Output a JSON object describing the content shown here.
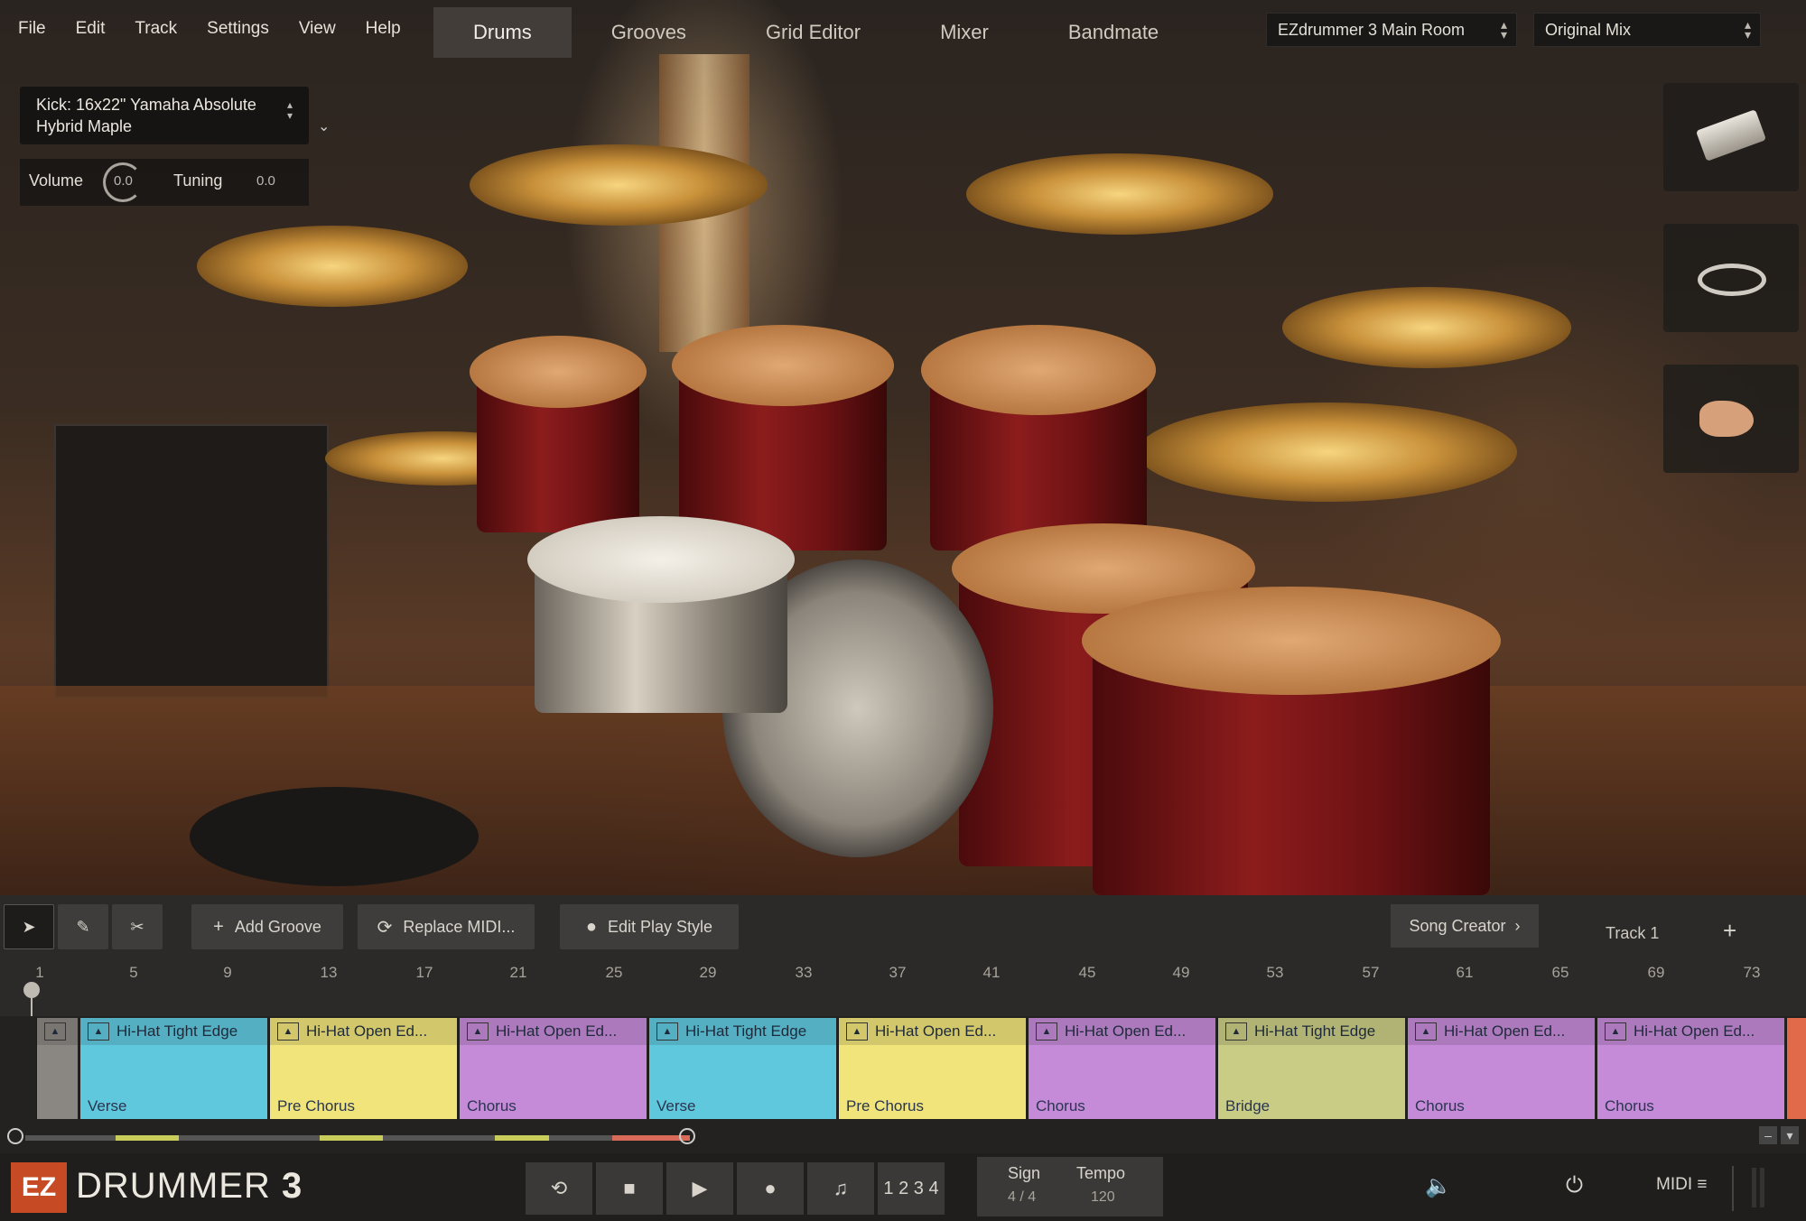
{
  "menu": [
    "File",
    "Edit",
    "Track",
    "Settings",
    "View",
    "Help"
  ],
  "tabs": [
    {
      "label": "Drums",
      "active": true
    },
    {
      "label": "Grooves",
      "active": false
    },
    {
      "label": "Grid Editor",
      "active": false
    },
    {
      "label": "Mixer",
      "active": false
    },
    {
      "label": "Bandmate",
      "active": false
    }
  ],
  "room_preset": "EZdrummer 3 Main Room",
  "mix_preset": "Original Mix",
  "instrument": {
    "name": "Kick: 16x22\" Yamaha Absolute Hybrid Maple",
    "volume_label": "Volume",
    "volume_value": "0.0",
    "tuning_label": "Tuning",
    "tuning_value": "0.0"
  },
  "toolbar": {
    "add_groove": "Add Groove",
    "replace_midi": "Replace MIDI...",
    "edit_play_style": "Edit Play Style",
    "song_creator": "Song Creator",
    "track_name": "Track 1"
  },
  "ruler": [
    "1",
    "5",
    "9",
    "13",
    "17",
    "21",
    "25",
    "29",
    "33",
    "37",
    "41",
    "45",
    "49",
    "53",
    "57",
    "61",
    "65",
    "69",
    "73"
  ],
  "clips": [
    {
      "title": "Hi-Hat Tight Edge",
      "part": "Verse",
      "color": "#5fc8dc"
    },
    {
      "title": "Hi-Hat Open Ed...",
      "part": "Pre Chorus",
      "color": "#f0e47a"
    },
    {
      "title": "Hi-Hat Open Ed...",
      "part": "Chorus",
      "color": "#c58ad8"
    },
    {
      "title": "Hi-Hat Tight Edge",
      "part": "Verse",
      "color": "#5fc8dc"
    },
    {
      "title": "Hi-Hat Open Ed...",
      "part": "Pre Chorus",
      "color": "#f0e47a"
    },
    {
      "title": "Hi-Hat Open Ed...",
      "part": "Chorus",
      "color": "#c58ad8"
    },
    {
      "title": "Hi-Hat Tight Edge",
      "part": "Bridge",
      "color": "#c9cc84"
    },
    {
      "title": "Hi-Hat Open Ed...",
      "part": "Chorus",
      "color": "#c58ad8"
    },
    {
      "title": "Hi-Hat Open Ed...",
      "part": "Chorus",
      "color": "#c58ad8"
    }
  ],
  "transport": {
    "logo_ez": "EZ",
    "logo_name": "DRUMMER",
    "logo_version": "3",
    "count_in": "1 2 3 4",
    "sign_label": "Sign",
    "sign_value": "4 / 4",
    "tempo_label": "Tempo",
    "tempo_value": "120",
    "midi_label": "MIDI"
  },
  "colors": {
    "accent": "#c64a24",
    "active_tab": "#46423e"
  }
}
